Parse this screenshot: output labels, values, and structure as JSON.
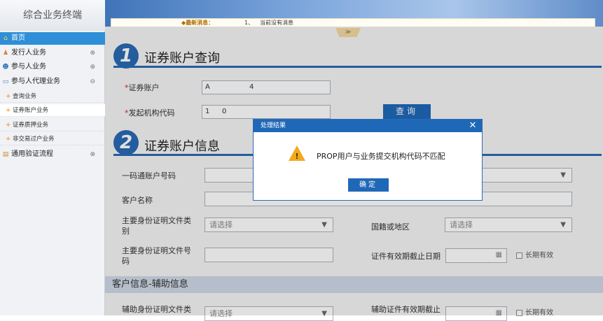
{
  "sidebar": {
    "brand": "综合业务终端",
    "items": [
      {
        "label": "首页",
        "toggle": ""
      },
      {
        "label": "发行人业务",
        "toggle": "⊕"
      },
      {
        "label": "参与人业务",
        "toggle": "⊕"
      },
      {
        "label": "参与人代理业务",
        "toggle": "⊖"
      },
      {
        "label": "查询业务"
      },
      {
        "label": "证券账户业务"
      },
      {
        "label": "证券质押业务"
      },
      {
        "label": "非交易过户业务"
      },
      {
        "label": "通用验证流程",
        "toggle": "⊕"
      }
    ]
  },
  "ticker": {
    "label": "◆最新消息：",
    "index": "1、",
    "text": "当前没有消息",
    "collapse": "≫"
  },
  "section1": {
    "number": "1",
    "title": "证券账户查询",
    "account_label": "证券账户",
    "account_value_prefix": "A",
    "account_value_suffix": "4",
    "org_label": "发起机构代码",
    "org_value_prefix": "1",
    "org_value_suffix": "0",
    "query_button": "查询",
    "required_mark": "*"
  },
  "section2": {
    "number": "2",
    "title": "证券账户信息",
    "one_code_label": "一码通账户号码",
    "customer_name_label": "客户名称",
    "main_id_type_label": "主要身份证明文件类别",
    "main_id_type_value": "请选择",
    "nationality_label": "国籍或地区",
    "nationality_value": "请选择",
    "main_id_no_label": "主要身份证明文件号码",
    "expiry_label": "证件有效期截止日期",
    "long_term_label": "长期有效"
  },
  "aux": {
    "band_title": "客户信息-辅助信息",
    "aux_id_type_label": "辅助身份证明文件类",
    "aux_id_type_value": "请选择",
    "aux_expiry_label": "辅助证件有效期截止",
    "long_term_label": "长期有效"
  },
  "dialog": {
    "title": "处理结果",
    "close": "✕",
    "message": "PROP用户与业务提交机构代码不匹配",
    "ok_button": "确定",
    "icon": "warning-icon"
  },
  "colors": {
    "accent": "#1f68b8",
    "warning": "#f2a91e",
    "required": "#e02020"
  }
}
